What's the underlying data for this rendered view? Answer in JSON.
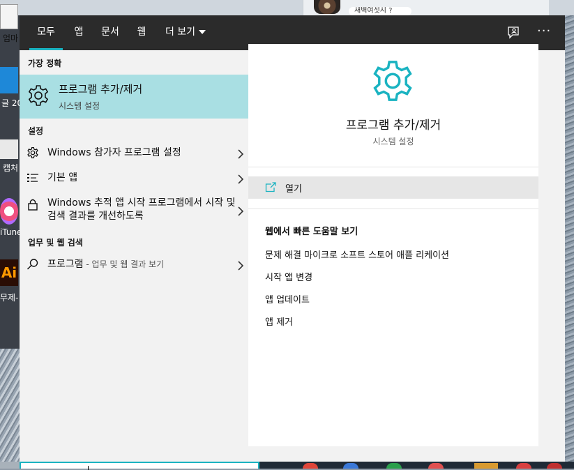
{
  "desktop": {
    "icons": [
      {
        "label": "엄마"
      },
      {
        "label": "글 20"
      },
      {
        "label": "캡처"
      },
      {
        "label": "iTune"
      },
      {
        "label": "무제-"
      }
    ],
    "ai_glyph": "Ai",
    "notification_text": "새벽여섯시 ?"
  },
  "tabs": [
    {
      "label": "모두",
      "active": true
    },
    {
      "label": "앱"
    },
    {
      "label": "문서"
    },
    {
      "label": "웹"
    },
    {
      "label": "더 보기"
    }
  ],
  "toolbar": {
    "more_glyph": "···"
  },
  "left": {
    "best_match_header": "가장 정확",
    "best_match": {
      "title": "프로그램 추가/제거",
      "subtitle": "시스템 설정"
    },
    "settings_header": "설정",
    "settings_items": [
      {
        "label": "Windows 참가자 프로그램 설정"
      },
      {
        "label": "기본 앱"
      },
      {
        "label": "Windows 추적 앱 시작 프로그램에서 시작 및 검색 결과를 개선하도록"
      }
    ],
    "web_header": "업무 및 웹 검색",
    "web_item": {
      "label": "프로그램",
      "suffix": " - 업무 및 웹 결과 보기"
    }
  },
  "right": {
    "title": "프로그램 추가/제거",
    "subtitle": "시스템 설정",
    "open_label": "열기",
    "web_help_header": "웹에서 빠른 도움말 보기",
    "links": [
      "문제 해결 마이크로 소프트 스토어 애플 리케이션",
      "시작 앱 변경",
      "앱 업데이트",
      "앱 제거"
    ]
  },
  "colors": {
    "accent": "#1ab3c1",
    "selected_bg": "#a9dfe3",
    "topbar_bg": "#2b2b2b"
  }
}
